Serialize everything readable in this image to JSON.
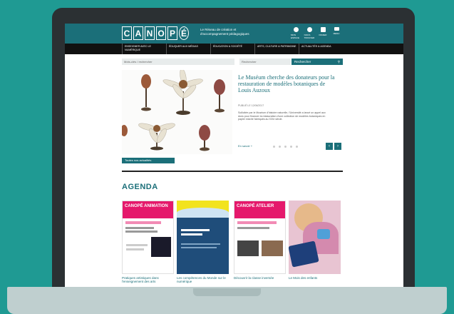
{
  "header": {
    "logo": [
      "C",
      "A",
      "N",
      "O",
      "P",
      "É"
    ],
    "tagline": "Le Réseau de création et d'accompagnement pédagogiques",
    "icons": [
      {
        "name": "user-icon",
        "label": "MON ESPACE"
      },
      {
        "name": "location-icon",
        "label": "NOUS TROUVER"
      },
      {
        "name": "cart-icon",
        "label": "PANIER"
      },
      {
        "name": "menu-icon",
        "label": "MENU"
      }
    ]
  },
  "nav": [
    "Enseigner avec le numérique",
    "Éduquer aux médias",
    "Éducation & société",
    "Arts, culture & patrimoine",
    "Actualités & agenda"
  ],
  "search": {
    "keyword_placeholder": "Mots-clés / rechercher",
    "category_placeholder": "Rechercher",
    "button_label": "Rechercher"
  },
  "hero": {
    "title": "Le Muséum cherche des donateurs pour la restauration de modèles botaniques de Louis Auzoux",
    "meta": "PUBLIÉ LE 12/06/2017",
    "text": "Sollicitée par le Muséum d'histoire naturelle, l'Université a lancé un appel aux dons pour financer la restauration d'une collection de modèles botaniques en papier mâché fabriqués au XIXe siècle.",
    "more_link": "En savoir +",
    "prev_label": "‹",
    "next_label": "›",
    "all_news_button": "Toutes nos actualités"
  },
  "agenda": {
    "title": "AGENDA",
    "cards": [
      {
        "caption": "Pratiques artistiques dans l'enseignement des arts",
        "tag": "CANOPÉ ANIMATION",
        "tag_color": "#e5186b"
      },
      {
        "caption": "Les compétences du Monde sur le numérique",
        "tag": "",
        "tag_color": "#1f4d7a"
      },
      {
        "caption": "Découvrir la classe inversée",
        "tag": "CANOPÉ ATELIER",
        "tag_color": "#e5186b"
      },
      {
        "caption": "Le Mois des enfants",
        "tag": "",
        "tag_color": "#d88fb0"
      }
    ]
  }
}
